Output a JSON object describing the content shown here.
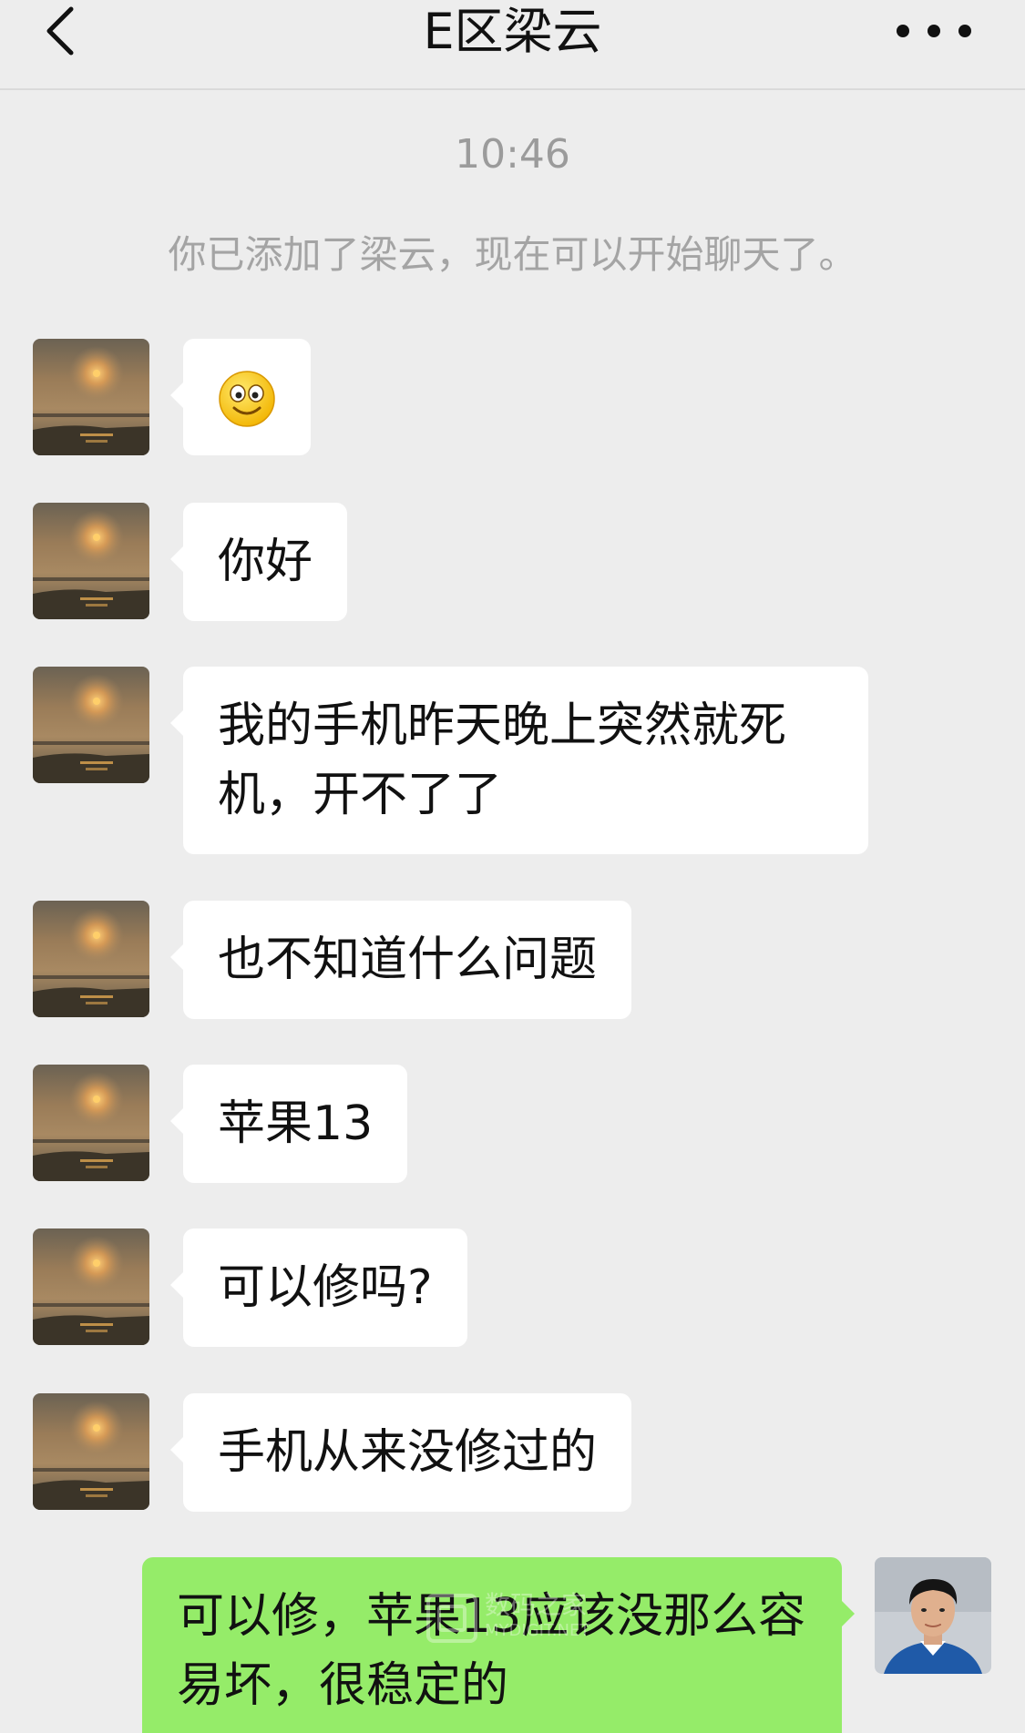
{
  "header": {
    "title": "E区梁云"
  },
  "chat": {
    "timestamp": "10:46",
    "system_message": "你已添加了梁云，现在可以开始聊天了。",
    "messages": [
      {
        "sender": "contact",
        "kind": "emoji",
        "emoji": "smiley-face-icon"
      },
      {
        "sender": "contact",
        "kind": "text",
        "text": "你好"
      },
      {
        "sender": "contact",
        "kind": "text",
        "text": "我的手机昨天晚上突然就死机，开不了了"
      },
      {
        "sender": "contact",
        "kind": "text",
        "text": "也不知道什么问题"
      },
      {
        "sender": "contact",
        "kind": "text",
        "text": "苹果13"
      },
      {
        "sender": "contact",
        "kind": "text",
        "text": "可以修吗?"
      },
      {
        "sender": "contact",
        "kind": "text",
        "text": "手机从来没修过的"
      },
      {
        "sender": "me",
        "kind": "text",
        "text": "可以修，苹果13应该没那么容易坏，很稳定的"
      }
    ]
  },
  "watermark": {
    "text": "数码之家",
    "subtext": "MYDIGIT.NET"
  },
  "colors": {
    "background": "#ededed",
    "incoming_bubble": "#ffffff",
    "outgoing_bubble": "#95ec69",
    "meta_text": "#9b9b9b"
  }
}
